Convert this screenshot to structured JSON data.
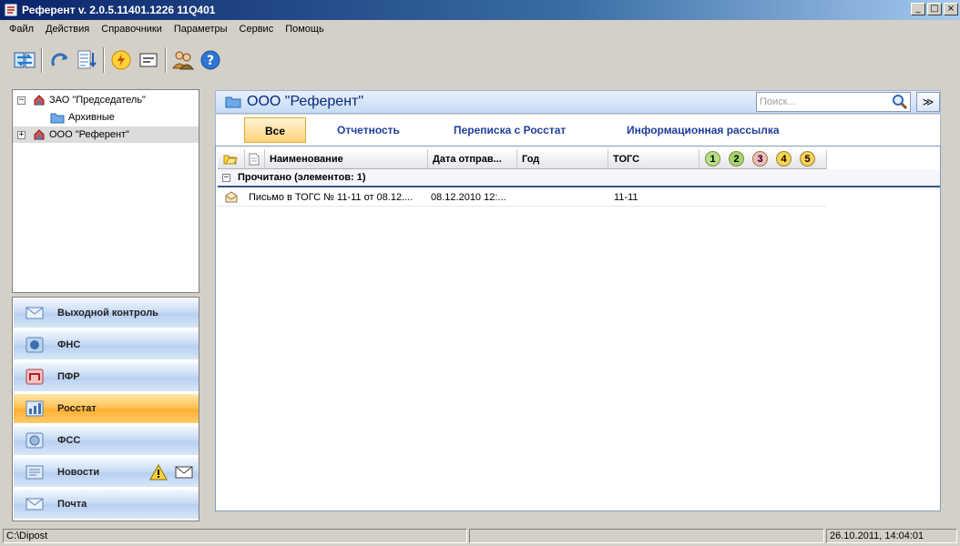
{
  "window": {
    "title": "Референт v. 2.0.5.11401.1226 11Q401",
    "buttons": [
      "_",
      "□",
      "×"
    ]
  },
  "menu": [
    "Файл",
    "Действия",
    "Справочники",
    "Параметры",
    "Сервис",
    "Помощь"
  ],
  "toolbar": {
    "buttons": [
      "exchange-icon",
      "refresh-icon",
      "sort-icon",
      "lightning-icon",
      "card-icon",
      "users-icon",
      "help-icon"
    ]
  },
  "tree": {
    "items": [
      {
        "label": "ЗАО \"Председатель\"",
        "expander": "−",
        "icon": "building-icon"
      },
      {
        "label": "Архивные",
        "icon": "folder-icon"
      },
      {
        "label": "ООО  \"Референт\"",
        "expander": "+",
        "icon": "building-icon",
        "selected": true
      }
    ]
  },
  "nav": {
    "items": [
      {
        "label": "Выходной контроль",
        "icon": "envelope-icon"
      },
      {
        "label": "ФНС",
        "icon": "fns-emblem-icon"
      },
      {
        "label": "ПФР",
        "icon": "pfr-emblem-icon"
      },
      {
        "label": "Росстат",
        "icon": "chart-icon",
        "active": true
      },
      {
        "label": "ФСС",
        "icon": "fss-emblem-icon"
      },
      {
        "label": "Новости",
        "icon": "news-icon",
        "extras": [
          "warning-icon",
          "mail-icon"
        ]
      },
      {
        "label": "Почта",
        "icon": "mail-icon"
      }
    ]
  },
  "main": {
    "org_title": "ООО  \"Референт\"",
    "search_placeholder": "Поиск...",
    "tabs": [
      "Все",
      "Отчетность",
      "Переписка с Росстат",
      "Информационная рассылка"
    ],
    "active_tab": "Все",
    "columns": [
      "Наименование",
      "Дата отправ...",
      "Год",
      "ТОГС"
    ],
    "status_badges": [
      {
        "num": "1",
        "color": "#b6e08a"
      },
      {
        "num": "2",
        "color": "#a6d46e"
      },
      {
        "num": "3",
        "color": "#f7b7c4"
      },
      {
        "num": "4",
        "color": "#ffd34e"
      },
      {
        "num": "5",
        "color": "#ffcf54"
      }
    ],
    "group_label": "Прочитано (элементов: 1)",
    "group_expander": "−",
    "rows": [
      {
        "name": "Письмо в ТОГС № 11-11 от 08.12....",
        "date": "08.12.2010 12:...",
        "year": "",
        "togs": "11-11"
      }
    ]
  },
  "status": {
    "path": "C:\\Dipost",
    "datetime": "26.10.2011, 14:04:01"
  }
}
